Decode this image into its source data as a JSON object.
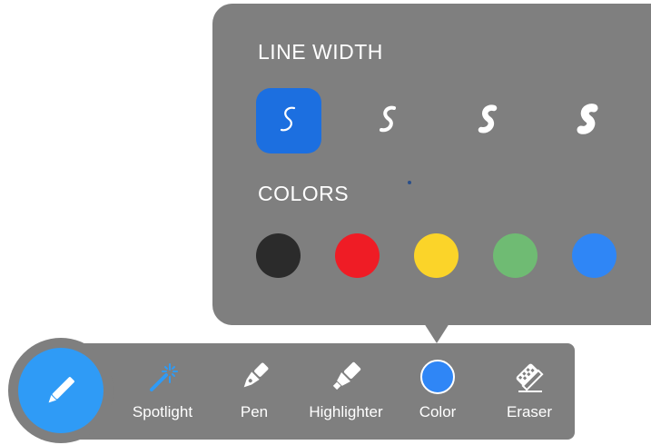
{
  "popover": {
    "line_width_title": "LINE WIDTH",
    "colors_title": "COLORS",
    "line_widths": [
      {
        "icon": "squiggle-thin-icon",
        "selected": true
      },
      {
        "icon": "squiggle-medium-icon",
        "selected": false
      },
      {
        "icon": "squiggle-thick-icon",
        "selected": false
      },
      {
        "icon": "squiggle-extra-thick-icon",
        "selected": false
      }
    ],
    "colors": [
      {
        "name": "black",
        "hex": "#2b2b2b"
      },
      {
        "name": "red",
        "hex": "#ef1c25"
      },
      {
        "name": "yellow",
        "hex": "#fbd429"
      },
      {
        "name": "green",
        "hex": "#6fbb73"
      },
      {
        "name": "blue",
        "hex": "#2f86f6"
      }
    ],
    "selected_line_width_color": "#1c6fe0"
  },
  "toolbar": {
    "fab_icon": "pencil-icon",
    "fab_color": "#2f9bf6",
    "tools": [
      {
        "label": "Spotlight",
        "icon": "magic-wand-icon",
        "active": true,
        "color": "#2f9bf6"
      },
      {
        "label": "Pen",
        "icon": "pen-nib-icon",
        "active": false
      },
      {
        "label": "Highlighter",
        "icon": "highlighter-icon",
        "active": false
      },
      {
        "label": "Color",
        "icon": "color-circle-icon",
        "active": false,
        "color": "#2f86f6"
      },
      {
        "label": "Eraser",
        "icon": "eraser-icon",
        "active": false
      }
    ]
  }
}
